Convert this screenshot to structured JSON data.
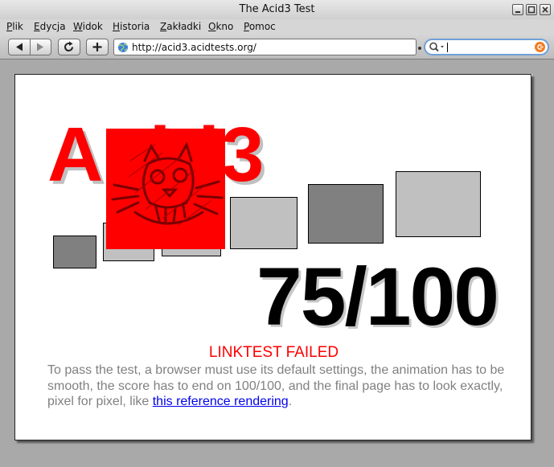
{
  "window": {
    "title": "The Acid3 Test"
  },
  "menu": {
    "items": [
      {
        "first": "P",
        "rest": "lik"
      },
      {
        "first": "E",
        "rest": "dycja"
      },
      {
        "first": "W",
        "rest": "idok"
      },
      {
        "first": "H",
        "rest": "istoria"
      },
      {
        "first": "Z",
        "rest": "akładki"
      },
      {
        "first": "O",
        "rest": "kno"
      },
      {
        "first": "P",
        "rest": "omoc"
      }
    ]
  },
  "toolbar": {
    "back_icon": "back-arrow-icon",
    "forward_icon": "forward-arrow-icon",
    "reload_icon": "reload-icon",
    "add_icon": "plus-icon",
    "url": "http://acid3.acidtests.org/",
    "search_value": ""
  },
  "page": {
    "title": "Acid3",
    "score": "75/100",
    "status": "LINKTEST FAILED",
    "description_before": "To pass the test, a browser must use its default settings, the animation has to be smooth, the score has to end on 100/100, and the final page has to look exactly, pixel for pixel, like ",
    "description_link": "this reference rendering",
    "description_after": ".",
    "colors": {
      "title": "#ff0000",
      "status": "#ff0000",
      "description": "#808080",
      "link": "#0000ee",
      "score": "#000000",
      "box_dark": "#808080",
      "box_light": "#c0c0c0",
      "failure_box": "#ff0000"
    }
  }
}
